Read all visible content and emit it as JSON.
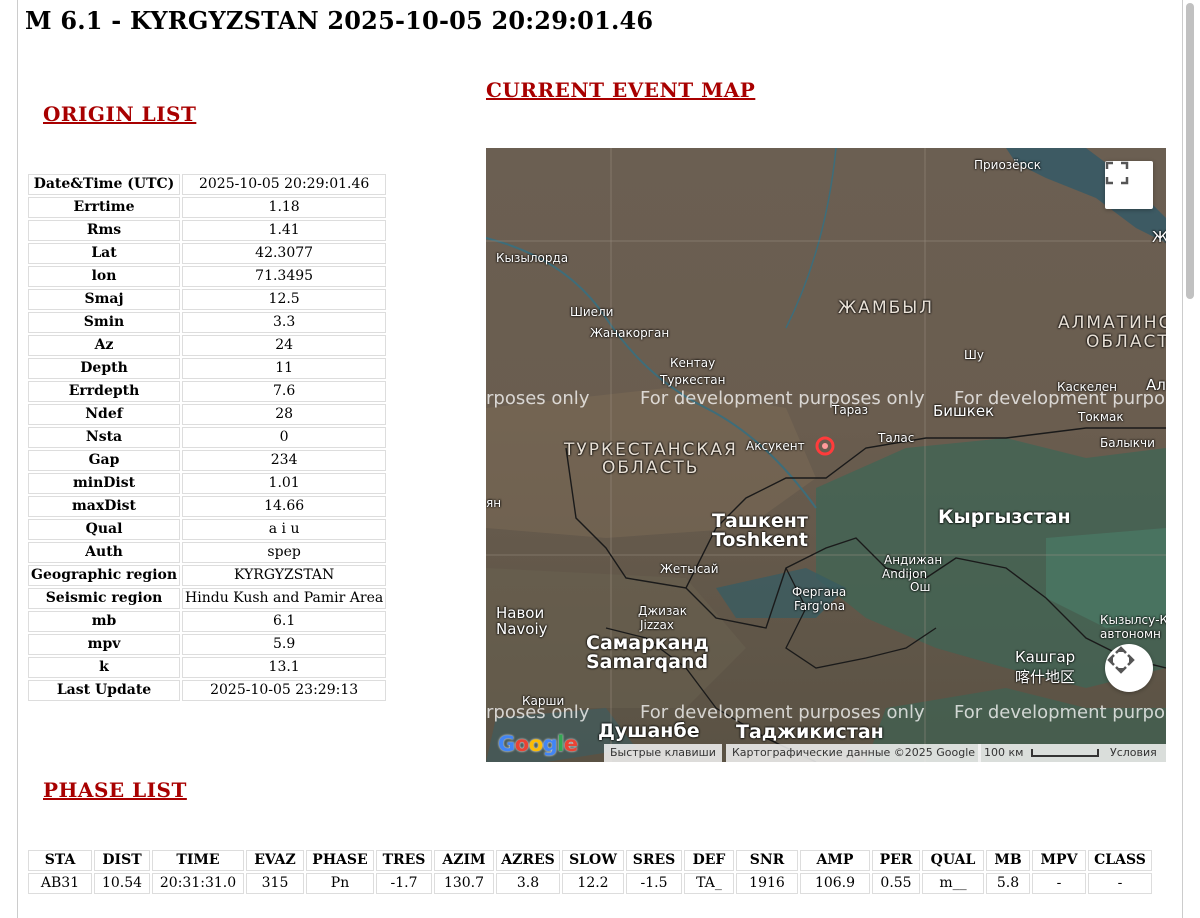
{
  "title": "M 6.1 - KYRGYZSTAN 2025-10-05 20:29:01.46",
  "links": {
    "current_event_map": "CURRENT EVENT MAP",
    "origin_list": "ORIGIN LIST",
    "phase_list": "PHASE LIST"
  },
  "origin": [
    {
      "key": "Date&Time (UTC)",
      "value": "2025-10-05 20:29:01.46"
    },
    {
      "key": "Errtime",
      "value": "1.18"
    },
    {
      "key": "Rms",
      "value": "1.41"
    },
    {
      "key": "Lat",
      "value": "42.3077"
    },
    {
      "key": "lon",
      "value": "71.3495"
    },
    {
      "key": "Smaj",
      "value": "12.5"
    },
    {
      "key": "Smin",
      "value": "3.3"
    },
    {
      "key": "Az",
      "value": "24"
    },
    {
      "key": "Depth",
      "value": "11"
    },
    {
      "key": "Errdepth",
      "value": "7.6"
    },
    {
      "key": "Ndef",
      "value": "28"
    },
    {
      "key": "Nsta",
      "value": "0"
    },
    {
      "key": "Gap",
      "value": "234"
    },
    {
      "key": "minDist",
      "value": "1.01"
    },
    {
      "key": "maxDist",
      "value": "14.66"
    },
    {
      "key": "Qual",
      "value": "a i u"
    },
    {
      "key": "Auth",
      "value": "spep"
    },
    {
      "key": "Geographic region",
      "value": "KYRGYZSTAN"
    },
    {
      "key": "Seismic region",
      "value": "Hindu Kush and Pamir Area"
    },
    {
      "key": "mb",
      "value": "6.1"
    },
    {
      "key": "mpv",
      "value": "5.9"
    },
    {
      "key": "k",
      "value": "13.1"
    },
    {
      "key": "Last Update",
      "value": "2025-10-05 23:29:13"
    }
  ],
  "map": {
    "watermark": "For development purposes only",
    "watermark_left": "rposes only",
    "watermark_right": "For development purpose",
    "labels": {
      "priozersk": "Приозёрск",
      "kyzylorda": "Кызылорда",
      "zhambyl": "ЖАМБЫЛ",
      "almaty1": "АЛМАТИНС",
      "almaty2": "ОБЛАСТ",
      "shieli": "Шиели",
      "zhanakorgan": "Жанакорган",
      "shu": "Шу",
      "kentau": "Кентау",
      "turkestan": "Туркестан",
      "kaskelen": "Каскелен",
      "al": "Ал",
      "taraz": "Тараз",
      "bishkek": "Бишкек",
      "tokmak": "Токмак",
      "turk_region1": "ТУРКЕСТАНСКАЯ",
      "turk_region2": "ОБЛАСТЬ",
      "aksukent": "Аксукент",
      "talas": "Талас",
      "balykchy": "Балыкчи",
      "tashkent_ru": "Ташкент",
      "tashkent_uz": "Toshkent",
      "kyrgyzstan": "Кыргызстан",
      "andijan_ru": "Андижан",
      "andijan_uz": "Andijon",
      "osh": "Ош",
      "zhetysai": "Жетысай",
      "fergana_ru": "Фергана",
      "fergana_uz": "Farg'ona",
      "navoi_ru": "Навои",
      "navoi_uz": "Navoiy",
      "jizzakh_ru": "Джизак",
      "jizzakh_uz": "Jizzax",
      "kyzylsu1": "Кызылсу-К",
      "kyzylsu2": "автономн",
      "samarkand_ru": "Самарканд",
      "samarkand_uz": "Samarqand",
      "kashgar_ru": "Кашгар",
      "kashgar_cn": "喀什地区",
      "karshi": "Карши",
      "dushanbe": "Душанбе",
      "tajikistan": "Таджикистан",
      "ln": "ян",
      "zh": "Ж"
    },
    "google_logo": "Google",
    "footer": {
      "shortcuts": "Быстрые клавиши",
      "mapdata": "Картографические данные ©2025 Google",
      "scale": "100 км",
      "terms": "Условия"
    },
    "icons": {
      "fullscreen": "fullscreen-icon",
      "pan": "pan-control-icon",
      "marker": "epicenter-marker-icon"
    }
  },
  "phase": {
    "headers": [
      "STA",
      "DIST",
      "TIME",
      "EVAZ",
      "PHASE",
      "TRES",
      "AZIM",
      "AZRES",
      "SLOW",
      "SRES",
      "DEF",
      "SNR",
      "AMP",
      "PER",
      "QUAL",
      "MB",
      "MPV",
      "CLASS"
    ],
    "rows": [
      [
        "AB31",
        "10.54",
        "20:31:31.0",
        "315",
        "Pn",
        "-1.7",
        "130.7",
        "3.8",
        "12.2",
        "-1.5",
        "TA_",
        "1916",
        "106.9",
        "0.55",
        "m__",
        "5.8",
        "-",
        "-"
      ]
    ]
  }
}
